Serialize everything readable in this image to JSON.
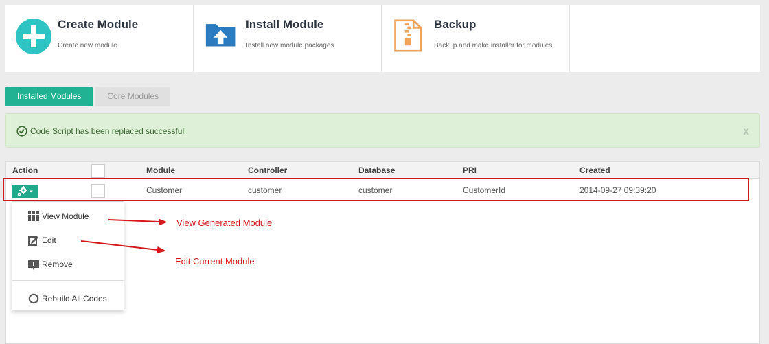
{
  "colors": {
    "accent_teal": "#21b193",
    "create_icon": "#2fc4c4",
    "install_icon": "#2b7bc0",
    "backup_icon": "#f0a45a",
    "alert_bg": "#dff0d8",
    "annotation_red": "#d4171a"
  },
  "cards": [
    {
      "title": "Create Module",
      "desc": "Create new module",
      "icon": "plus-circle-icon"
    },
    {
      "title": "Install Module",
      "desc": "Install new module packages",
      "icon": "folder-upload-icon"
    },
    {
      "title": "Backup",
      "desc": "Backup and make installer for modules",
      "icon": "zip-file-icon"
    }
  ],
  "tabs": [
    {
      "label": "Installed Modules",
      "active": true
    },
    {
      "label": "Core Modules",
      "active": false
    }
  ],
  "alert": {
    "message": "Code Script has been replaced successfull",
    "close": "x",
    "icon": "check-circle-icon"
  },
  "table": {
    "headers": {
      "action": "Action",
      "module": "Module",
      "controller": "Controller",
      "database": "Database",
      "pri": "PRI",
      "created": "Created"
    },
    "rows": [
      {
        "module": "Customer",
        "controller": "customer",
        "database": "customer",
        "pri": "CustomerId",
        "created": "2014-09-27 09:39:20"
      }
    ]
  },
  "action_menu": {
    "items": [
      {
        "label": "View Module",
        "icon": "grid-icon"
      },
      {
        "label": "Edit",
        "icon": "edit-icon"
      },
      {
        "label": "Remove",
        "icon": "remove-icon"
      },
      {
        "label": "Rebuild All Codes",
        "icon": "refresh-icon"
      }
    ]
  },
  "annotations": {
    "view": "View Generated Module",
    "edit": "Edit Current Module"
  }
}
